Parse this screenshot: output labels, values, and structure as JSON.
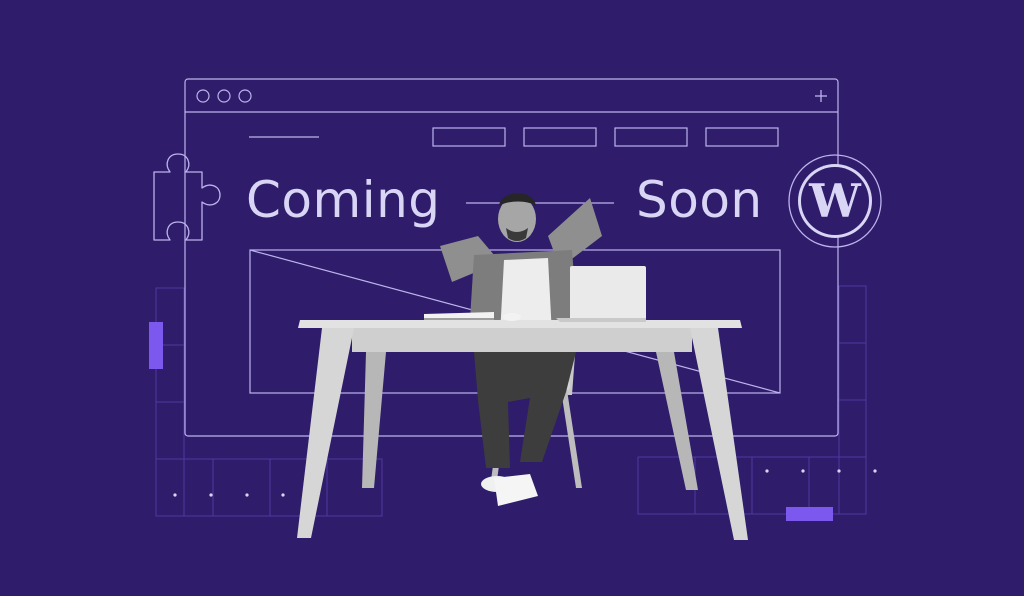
{
  "headline": {
    "word_left": "Coming",
    "word_right": "Soon"
  },
  "logo": {
    "letter": "W"
  },
  "icons": [
    "puzzle-piece-icon",
    "wordpress-logo-icon",
    "add-tab-icon",
    "window-control-dots"
  ],
  "colors": {
    "background": "#2f1c6a",
    "outline": "#bdb4ee",
    "accent": "#7d58ef",
    "headline_text": "#d9d5f5"
  }
}
